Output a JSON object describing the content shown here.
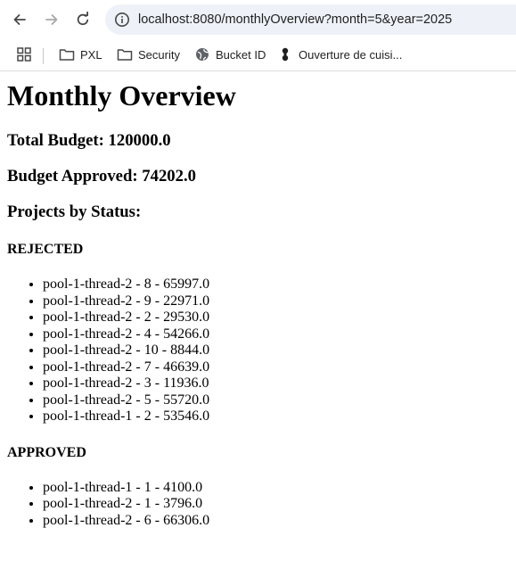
{
  "browser": {
    "url": "localhost:8080/monthlyOverview?month=5&year=2025",
    "bookmarks": [
      {
        "label": "PXL",
        "icon": "folder-icon"
      },
      {
        "label": "Security",
        "icon": "folder-icon"
      },
      {
        "label": "Bucket ID",
        "icon": "globe-icon"
      },
      {
        "label": "Ouverture de cuisi...",
        "icon": "bookmark-favicon-icon"
      }
    ]
  },
  "page": {
    "title": "Monthly Overview",
    "total_budget": "Total Budget: 120000.0",
    "budget_approved": "Budget Approved: 74202.0",
    "projects_heading": "Projects by Status:",
    "statuses": [
      {
        "name": "REJECTED",
        "items": [
          "pool-1-thread-2 - 8 - 65997.0",
          "pool-1-thread-2 - 9 - 22971.0",
          "pool-1-thread-2 - 2 - 29530.0",
          "pool-1-thread-2 - 4 - 54266.0",
          "pool-1-thread-2 - 10 - 8844.0",
          "pool-1-thread-2 - 7 - 46639.0",
          "pool-1-thread-2 - 3 - 11936.0",
          "pool-1-thread-2 - 5 - 55720.0",
          "pool-1-thread-1 - 2 - 53546.0"
        ]
      },
      {
        "name": "APPROVED",
        "items": [
          "pool-1-thread-1 - 1 - 4100.0",
          "pool-1-thread-2 - 1 - 3796.0",
          "pool-1-thread-2 - 6 - 66306.0"
        ]
      }
    ]
  }
}
